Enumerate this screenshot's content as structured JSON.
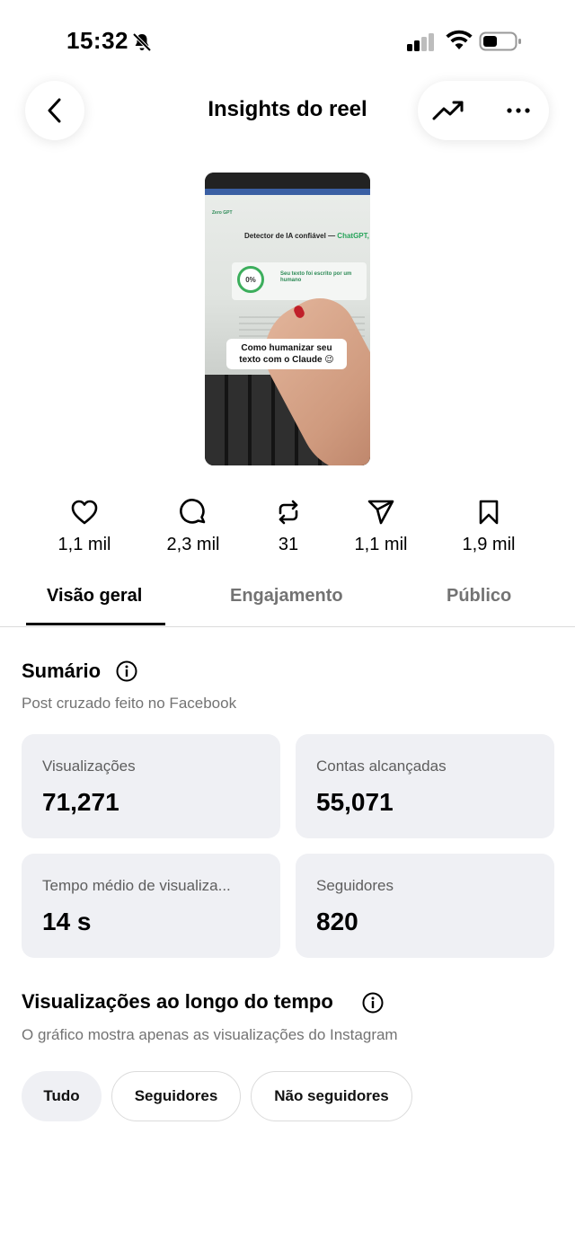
{
  "status_bar": {
    "time": "15:32"
  },
  "header": {
    "title": "Insights do reel"
  },
  "thumbnail": {
    "logo": "Zero GPT",
    "heading": "Detector de IA confiável — ",
    "heading_accent": "ChatGPT,",
    "score": "0%",
    "result": "Seu texto foi escrito por um humano",
    "caption": "Como humanizar seu texto com o Claude 😉"
  },
  "stats": [
    {
      "icon": "heart-icon",
      "value": "1,1 mil"
    },
    {
      "icon": "comment-icon",
      "value": "2,3 mil"
    },
    {
      "icon": "repost-icon",
      "value": "31"
    },
    {
      "icon": "share-icon",
      "value": "1,1 mil"
    },
    {
      "icon": "bookmark-icon",
      "value": "1,9 mil"
    }
  ],
  "tabs": [
    {
      "label": "Visão geral",
      "active": true
    },
    {
      "label": "Engajamento",
      "active": false
    },
    {
      "label": "Público",
      "active": false
    }
  ],
  "summary": {
    "title": "Sumário",
    "subtitle": "Post cruzado feito no Facebook",
    "metrics": [
      {
        "label": "Visualizações",
        "value": "71,271"
      },
      {
        "label": "Contas alcançadas",
        "value": "55,071"
      },
      {
        "label": "Tempo médio de visualiza...",
        "value": "14 s"
      },
      {
        "label": "Seguidores",
        "value": "820"
      }
    ]
  },
  "views_over_time": {
    "title": "Visualizações ao longo do tempo",
    "subtitle": "O gráfico mostra apenas as visualizações do Instagram",
    "filters": [
      {
        "label": "Tudo",
        "selected": true
      },
      {
        "label": "Seguidores",
        "selected": false
      },
      {
        "label": "Não seguidores",
        "selected": false
      }
    ]
  }
}
